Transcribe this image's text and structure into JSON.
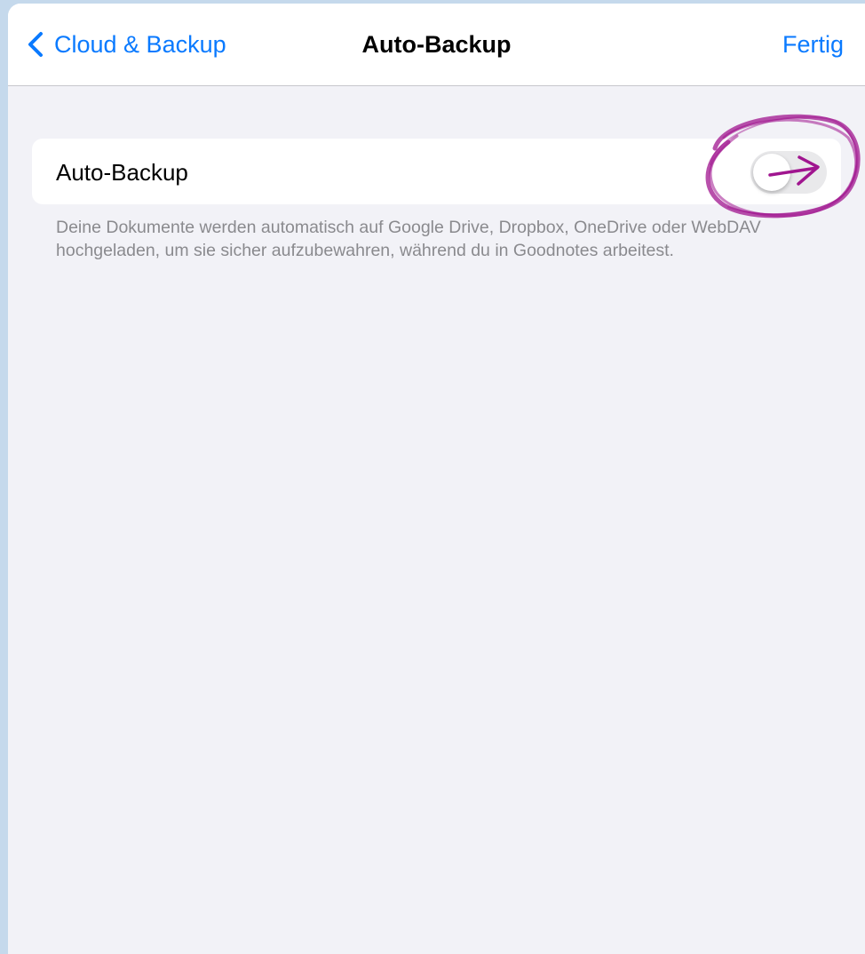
{
  "navbar": {
    "back_label": "Cloud & Backup",
    "title": "Auto-Backup",
    "done_label": "Fertig"
  },
  "settings": {
    "auto_backup_label": "Auto-Backup",
    "auto_backup_enabled": false,
    "footer_text": "Deine Dokumente werden automatisch auf Google Drive, Dropbox, OneDrive oder WebDAV hochgeladen, um sie sicher aufzubewahren, während du in Goodnotes arbeitest."
  },
  "colors": {
    "accent": "#0a7aff",
    "background": "#f2f2f7",
    "annotation": "#a0158f"
  },
  "icons": {
    "back": "chevron-left-icon",
    "annotation_circle": "hand-drawn-circle",
    "annotation_arrow": "hand-drawn-arrow-icon"
  }
}
